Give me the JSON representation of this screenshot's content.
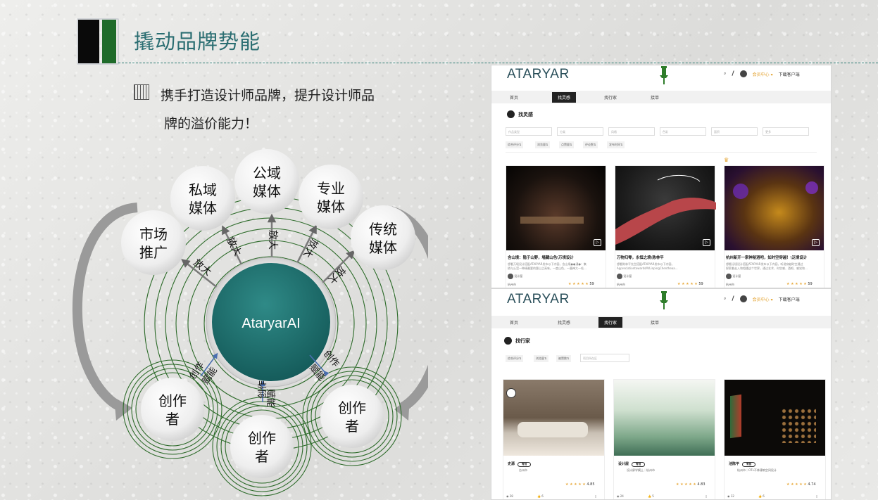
{
  "header": {
    "title": "撬动品牌势能"
  },
  "intro": {
    "line1": "携手打造设计师品牌，提升设计师品",
    "line2": "牌的溢价能力！"
  },
  "diagram": {
    "center": "AtaryarAI",
    "media": [
      {
        "l1": "市场",
        "l2": "推广"
      },
      {
        "l1": "私域",
        "l2": "媒体"
      },
      {
        "l1": "公域",
        "l2": "媒体"
      },
      {
        "l1": "专业",
        "l2": "媒体"
      },
      {
        "l1": "传统",
        "l2": "媒体"
      }
    ],
    "amplify_label": "放大",
    "creator": {
      "l1": "创作",
      "l2": "者"
    },
    "arrow_labels": {
      "create": "创作",
      "empower": "赋能"
    }
  },
  "shot1": {
    "logo": "ATARYAR",
    "topright": {
      "slash": "/",
      "member": "会员中心 ▾",
      "download": "下载客户端"
    },
    "nav": [
      "首页",
      "找灵感",
      "找行家",
      "接单"
    ],
    "nav_active": 1,
    "section": "找灵感",
    "filters": [
      "作品类型",
      "分类",
      "风格",
      "色彩",
      "面积",
      "更多"
    ],
    "sorts": [
      "综合评分⇅",
      "浏览量⇅",
      "点赞量⇅",
      "评论数⇅",
      "发布时间⇅"
    ],
    "cards": [
      {
        "title": "含山境：隐于山野，墙藏山色\\万境设计",
        "desc1": "想看万境设计搭配ATARYAR发布以下内容。含山境●●漫●：集",
        "desc2": "栖与丘滢一种精最要的惠山之高味。一度山色，一墨禅大一毛…",
        "author": "设计屋",
        "stars": "★ ★ ★ ★ ★",
        "score": "59",
        "city": "杭州市"
      },
      {
        "title": "万物归零，永恒之境\\陈林平",
        "desc1": "想看陈林平先生搭配ATARYAR发布以下内容。",
        "desc2": "AppreciationtowardsMrLinpingChentheaa…",
        "author": "设计屋",
        "stars": "★ ★ ★ ★ ★",
        "score": "59",
        "city": "杭州市"
      },
      {
        "title": "杭州新开一家神秘酒吧，如时空穿越！\\泛境设计",
        "desc1": "想看泛境设计搭配ATARYAR发布以下内容。听说穿越时空通过",
        "desc2": "探索着走入和相遇这个世界。通过艺术、时空感、酒吧、感觉和…",
        "author": "设计屋",
        "stars": "★ ★ ★ ★ ★",
        "score": "59",
        "city": "杭州市"
      }
    ]
  },
  "shot2": {
    "logo": "ATARYAR",
    "topright": {
      "slash": "/",
      "member": "会员中心 ▾",
      "download": "下载客户端"
    },
    "nav": [
      "首页",
      "找灵感",
      "找行家",
      "接单"
    ],
    "nav_active": 2,
    "section": "找行家",
    "sorts": [
      "综合评分⇅",
      "浏览量⇅",
      "被赞数⇅"
    ],
    "select_placeholder": "项目所在区",
    "cards": [
      {
        "name": "史源",
        "tag": "有创",
        "loc": "台州市",
        "stars": "★ ★ ★ ★ ★",
        "score": "4.85",
        "views": "28",
        "likes": "6"
      },
      {
        "name": "设计屋",
        "tag": "有创",
        "loc": "设计屏学模土｜杭州市",
        "stars": "★ ★ ★ ★ ★",
        "score": "4.83",
        "views": "24",
        "likes": "5"
      },
      {
        "name": "池陈平",
        "tag": "有创",
        "loc": "杭州市｜OTL不休建筑空间设计",
        "stars": "★ ★ ★ ★ ★",
        "score": "4.74",
        "views": "12",
        "likes": "6"
      }
    ]
  },
  "colors": {
    "teal": "#2b6e72",
    "green": "#1f6b2a",
    "hub": "#1f7a78"
  }
}
